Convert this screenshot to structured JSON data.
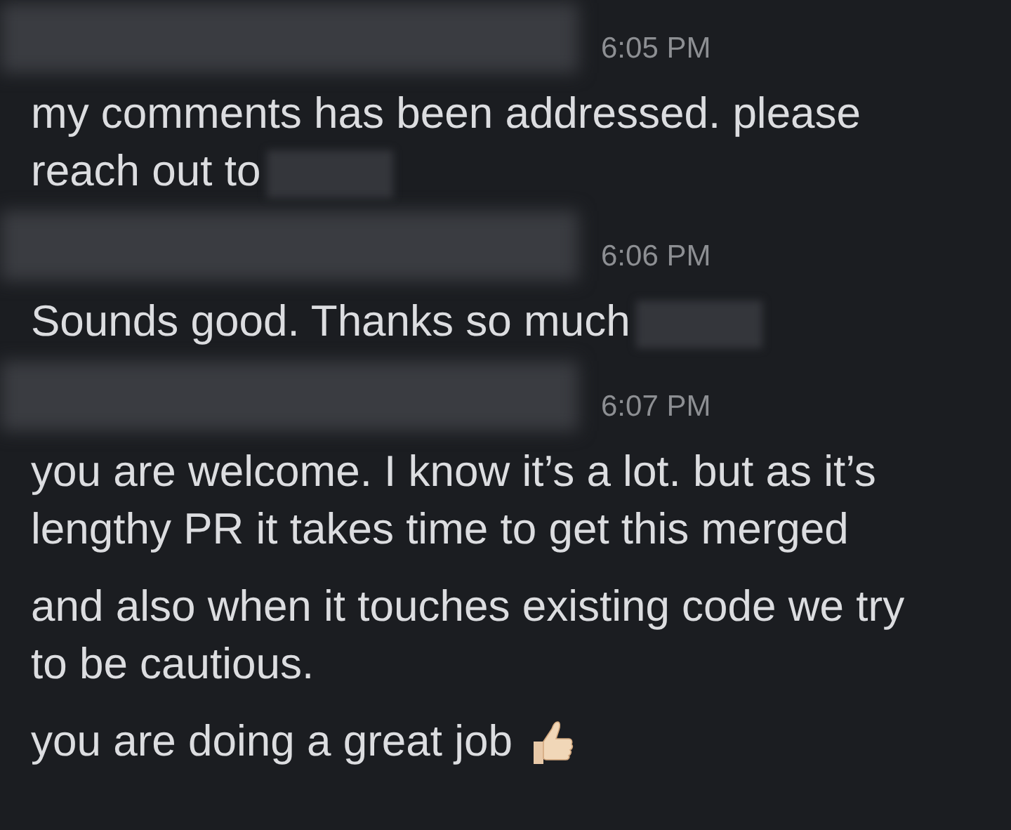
{
  "messages": [
    {
      "time": "6:05 PM",
      "paragraphs": [
        {
          "text": "my comments has been addressed. please reach out to",
          "redacted_end": true
        }
      ]
    },
    {
      "time": "6:06 PM",
      "paragraphs": [
        {
          "text": "Sounds good. Thanks so much",
          "redacted_end": true
        }
      ]
    },
    {
      "time": "6:07 PM",
      "paragraphs": [
        {
          "text": "you are welcome. I know it’s a lot. but as it’s lengthy PR it takes time to get this merged"
        },
        {
          "text": "and also when it touches existing code we try to be cautious."
        },
        {
          "text": "you are doing a great job",
          "thumbs_up": true
        }
      ]
    }
  ]
}
